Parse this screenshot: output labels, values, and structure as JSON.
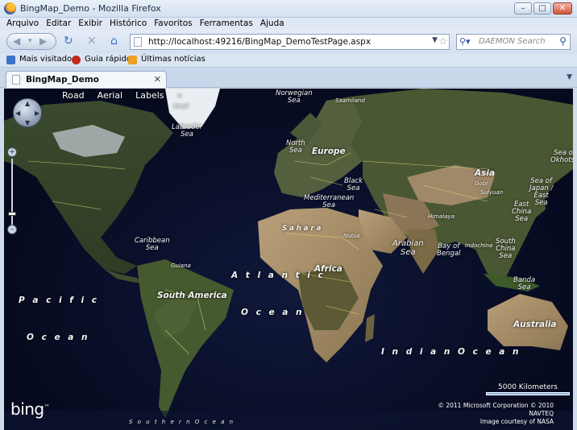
{
  "window": {
    "title": "BingMap_Demo - Mozilla Firefox",
    "controls": [
      "minimize",
      "maximize",
      "close"
    ]
  },
  "menu": [
    "Arquivo",
    "Editar",
    "Exibir",
    "Histórico",
    "Favoritos",
    "Ferramentas",
    "Ajuda"
  ],
  "nav": {
    "url": "http://localhost:49216/BingMap_DemoTestPage.aspx",
    "search_placeholder": "DAEMON Search"
  },
  "bookmarks": [
    {
      "label": "Mais visitados",
      "color": "#3a74c9"
    },
    {
      "label": "Guia rápido",
      "color": "#c42a1a"
    },
    {
      "label": "Últimas notícias",
      "color": "#f0a020"
    }
  ],
  "tab": {
    "label": "BingMap_Demo"
  },
  "map": {
    "modes": [
      "Road",
      "Aerial",
      "Labels",
      "«"
    ],
    "labels": {
      "strait": "Strait",
      "norwegian_sea": "Norwegian\nSea",
      "saamiland": "Saamiland",
      "labrador_sea": "Labrador\nSea",
      "north_sea": "North\nSea",
      "europe": "Europe",
      "asia": "Asia",
      "sea_of_okhotsk": "Sea of\nOkhotsk",
      "gobi": "Gobi",
      "sulyuan": "Sulyuan",
      "black_sea": "Black\nSea",
      "sea_of_japan": "Sea of\nJapan /\nEast\nSea",
      "mediterranean_sea": "Mediterranean\nSea",
      "east_china_sea": "East\nChina\nSea",
      "himalaya": "Himalaya",
      "sahara": "S a h a r a",
      "nubia": "Nubia",
      "arabian_sea": "Arabian\nSea",
      "bay_of_bengal": "Bay of\nBengal",
      "indochina": "Indochina",
      "south_china_sea": "South\nChina\nSea",
      "caribbean_sea": "Caribbean\nSea",
      "guiana": "Guiana",
      "africa": "Africa",
      "atlantic": "A t l a n t i c",
      "south_america": "South America",
      "pacific": "P a c i f i c",
      "ocean_atl": "O c e a n",
      "banda_sea": "Banda\nSea",
      "ocean_pac": "O c e a n",
      "australia": "Australia",
      "indian_ocean": "I n d i a n   O c e a n",
      "southern_ocean": "S o u t h e r n          O c e a n"
    },
    "scale": "5000 Kilometers",
    "copyright": [
      "© 2011 Microsoft Corporation    © 2010 NAVTEQ",
      "Image courtesy of NASA"
    ],
    "logo": "bing"
  }
}
